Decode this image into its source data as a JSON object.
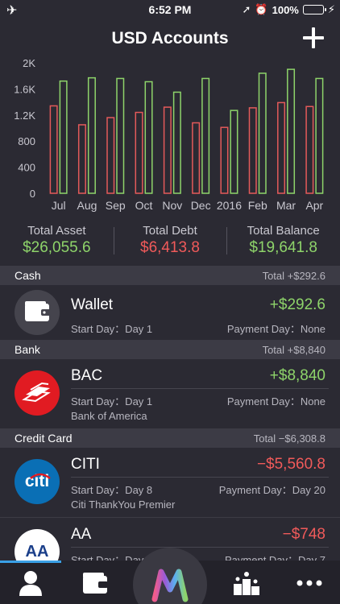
{
  "status": {
    "time": "6:52 PM",
    "battery": "100%",
    "left_icon": "airplane-icon"
  },
  "nav": {
    "title": "USD Accounts",
    "add_icon": "plus-icon"
  },
  "chart_data": {
    "type": "bar",
    "categories": [
      "Jul",
      "Aug",
      "Sep",
      "Oct",
      "Nov",
      "Dec",
      "2016",
      "Feb",
      "Mar",
      "Apr"
    ],
    "series": [
      {
        "color": "#e45a5a",
        "values": [
          1340,
          1050,
          1160,
          1240,
          1320,
          1080,
          1010,
          1310,
          1390,
          1330
        ]
      },
      {
        "color": "#8ed46a",
        "values": [
          1720,
          1770,
          1760,
          1710,
          1550,
          1760,
          1270,
          1840,
          1900,
          1760
        ]
      }
    ],
    "yticks": [
      "0",
      "400",
      "800",
      "1.2K",
      "1.6K",
      "2K"
    ],
    "ylim": [
      0,
      2000
    ]
  },
  "summary": {
    "asset_label": "Total Asset",
    "asset_value": "$26,055.6",
    "debt_label": "Total Debt",
    "debt_value": "$6,413.8",
    "balance_label": "Total Balance",
    "balance_value": "$19,641.8"
  },
  "sections": {
    "cash": {
      "title": "Cash",
      "total": "Total +$292.6"
    },
    "bank": {
      "title": "Bank",
      "total": "Total +$8,840"
    },
    "credit": {
      "title": "Credit Card",
      "total": "Total −$6,308.8"
    }
  },
  "accounts": {
    "wallet": {
      "name": "Wallet",
      "amount": "+$292.6",
      "start": "Start Day：Day 1",
      "payment": "Payment Day：None"
    },
    "bac": {
      "name": "BAC",
      "amount": "+$8,840",
      "start": "Start Day：Day 1",
      "payment": "Payment Day：None",
      "desc": "Bank of America"
    },
    "citi": {
      "name": "CITI",
      "amount": "−$5,560.8",
      "start": "Start Day：Day 8",
      "payment": "Payment Day：Day 20",
      "desc": "Citi ThankYou Premier",
      "logo_text": "citi"
    },
    "aa": {
      "name": "AA",
      "amount": "−$748",
      "start": "Start Day：Day",
      "payment": "Payment Day：Day 7",
      "logo_text": "AA"
    }
  },
  "tabs": [
    "person-icon",
    "wallet-icon",
    "m-logo-icon",
    "ranking-icon",
    "more-icon"
  ]
}
